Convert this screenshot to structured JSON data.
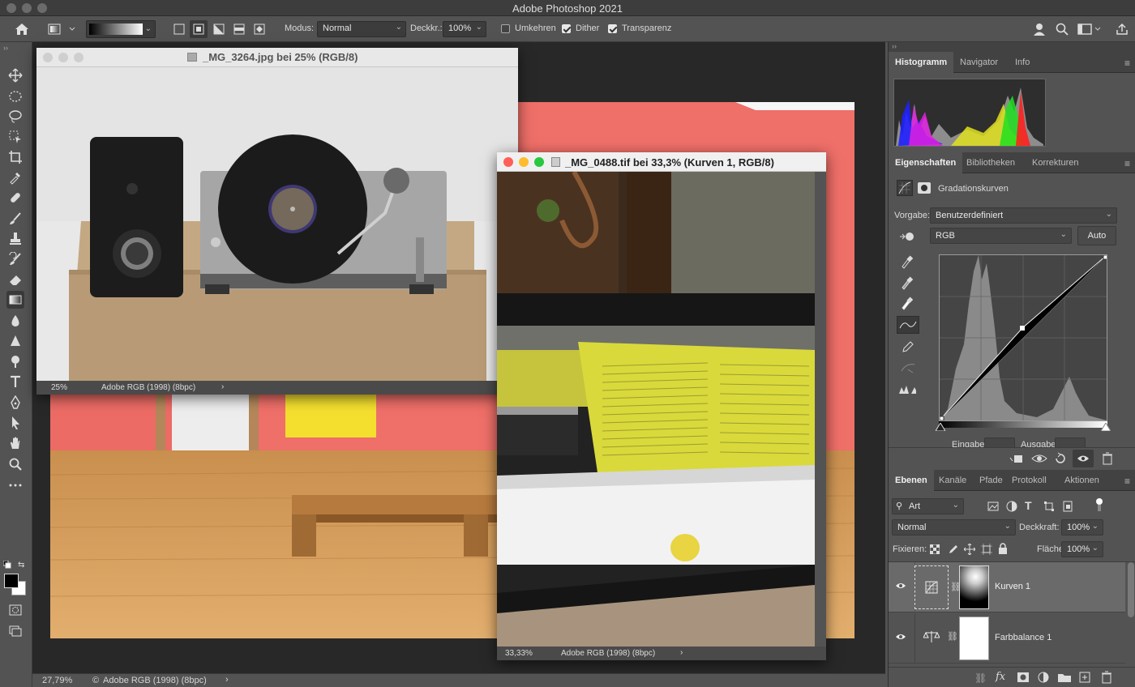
{
  "app": {
    "title": "Adobe Photoshop 2021"
  },
  "options": {
    "modus_label": "Modus:",
    "modus_value": "Normal",
    "deckkr_label": "Deckkr.:",
    "deckkr_value": "100%",
    "umkehren_label": "Umkehren",
    "umkehren_checked": false,
    "dither_label": "Dither",
    "dither_checked": true,
    "transparenz_label": "Transparenz",
    "transparenz_checked": true
  },
  "tools": [
    "move-icon",
    "marquee-icon",
    "lasso-icon",
    "object-select-icon",
    "crop-icon",
    "eyedropper-icon",
    "healing-icon",
    "brush-icon",
    "stamp-icon",
    "history-brush-icon",
    "eraser-icon",
    "gradient-icon",
    "blur-icon",
    "sharpen-icon",
    "dodge-icon",
    "type-icon",
    "pen-icon",
    "path-select-icon",
    "hand-icon",
    "zoom-icon",
    "more-icon"
  ],
  "statusbar": {
    "zoom": "27,79%",
    "profile": "Adobe RGB (1998) (8bpc)"
  },
  "doc1": {
    "title": "_MG_3264.jpg bei 25% (RGB/8)",
    "zoom": "25%",
    "profile": "Adobe RGB (1998) (8bpc)"
  },
  "doc2": {
    "title": "_MG_0488.tif bei 33,3% (Kurven 1, RGB/8)",
    "zoom": "33,33%",
    "profile": "Adobe RGB (1998) (8bpc)"
  },
  "histogram_panel": {
    "tabs": [
      "Histogramm",
      "Navigator",
      "Info"
    ],
    "active": 0
  },
  "properties_panel": {
    "tabs": [
      "Eigenschaften",
      "Bibliotheken",
      "Korrekturen"
    ],
    "active": 0,
    "adjustment_title": "Gradationskurven",
    "vorgabe_label": "Vorgabe:",
    "vorgabe_value": "Benutzerdefiniert",
    "channel_value": "RGB",
    "auto_label": "Auto",
    "eingabe_label": "Eingabe:",
    "ausgabe_label": "Ausgabe:"
  },
  "layers_panel": {
    "tabs": [
      "Ebenen",
      "Kanäle",
      "Pfade",
      "Protokoll",
      "Aktionen"
    ],
    "active": 0,
    "filter_value": "Art",
    "blend_value": "Normal",
    "deckkraft_label": "Deckkraft:",
    "deckkraft_value": "100%",
    "fixieren_label": "Fixieren:",
    "flaeche_label": "Fläche:",
    "flaeche_value": "100%",
    "layers": [
      {
        "name": "Kurven 1",
        "selected": true
      },
      {
        "name": "Farbbalance 1",
        "selected": false
      }
    ]
  },
  "colors": {
    "accent_red": "#ff5f57",
    "accent_yellow": "#febc2e",
    "accent_green": "#28c840",
    "wall_pink": "#f0716b"
  }
}
